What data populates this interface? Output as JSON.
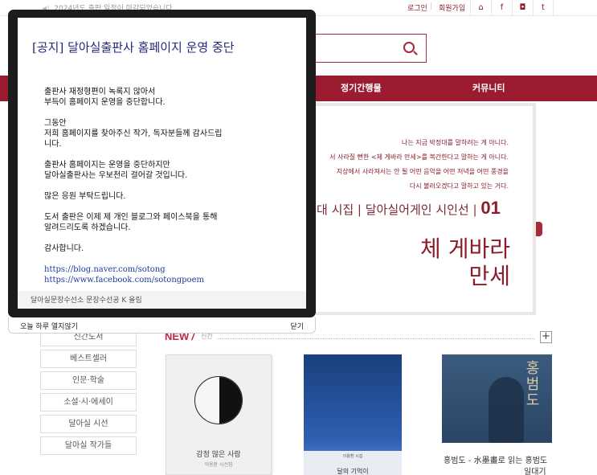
{
  "topbar": {
    "notice": "2024년도 출판 일정이 마감되었습니다",
    "login": "로그인",
    "join": "회원가입",
    "icons": [
      "home-icon",
      "facebook-icon",
      "instagram-icon",
      "twitter-icon"
    ],
    "icon_glyphs": {
      "home": "⌂",
      "facebook": "f",
      "instagram": "◘",
      "twitter": "t"
    }
  },
  "nav": {
    "items": [
      "정기간행물",
      "커뮤니티"
    ]
  },
  "banner": {
    "lines": [
      "나는 지금 박정대를 말하려는 게 아니다.",
      "서 사라질 뻔한 <체 게바라 만세>를 복간한다고 말하는 게 아니다.",
      "지상에서 사라져서는 안 될 어떤 음악을 어떤 저녁을 어떤 풍경을",
      "다시 불러오겠다고 말하고 있는 거다."
    ],
    "series": "대 시집 | 달아실어게인 시인선 |",
    "series_number": "01",
    "title_line1": "체 게바라",
    "title_line2": "만세"
  },
  "sidebar": {
    "items": [
      "신간도서",
      "베스트셀러",
      "인문·학술",
      "소설·시·에세이",
      "달아실 시선",
      "달아실 작가들"
    ]
  },
  "new_section": {
    "heading": "NEW",
    "slash": "/",
    "subheading": "신간",
    "more": "+"
  },
  "books": [
    {
      "title": "감정 많은 사람",
      "author": "이용환 시선집"
    },
    {
      "label": "이용환 시집",
      "title": "달의 기억이"
    },
    {
      "cover_title": "홍범도",
      "caption": "홍범도 - 水墨畫로 읽는 홍범도",
      "caption2": "일대기"
    }
  ],
  "popup": {
    "title": "[공지] 달아실출판사 홈페이지 운영 중단",
    "paragraphs": [
      [
        "출판사 재정형편이 녹록지 않아서",
        "부득이 홈페이지 운영을 중단합니다."
      ],
      [
        "그동안",
        "저희 홈페이지를 찾아주신 작가, 독자분들께 감사드립",
        "니다."
      ],
      [
        "출판사 홈페이지는 운영을 중단하지만",
        "달아실출판사는 우보천리 걸어갈 것입니다."
      ],
      [
        "많은 응원 부탁드립니다."
      ],
      [
        "도서 출판은 이제 제 개인 블로그와 페이스북을 통해",
        "알려드리도록 하겠습니다."
      ],
      [
        "감사합니다."
      ]
    ],
    "links": [
      "https://blog.naver.com/sotong",
      "https://www.facebook.com/sotongpoem"
    ],
    "signature": "달아실문장수선소 문장수선공 K 올림",
    "dont_show_today": "오늘 하루 열지않기",
    "close": "닫기"
  }
}
